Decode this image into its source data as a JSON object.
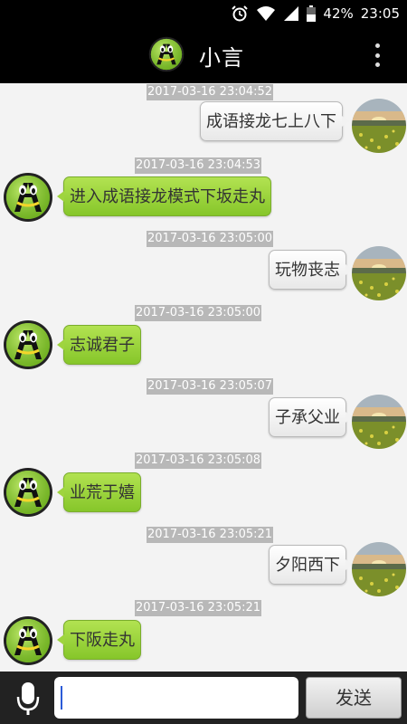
{
  "status_bar": {
    "battery": "42%",
    "time": "23:05",
    "icons": [
      "alarm-icon",
      "wifi-icon",
      "signal-icon",
      "battery-icon"
    ]
  },
  "app_bar": {
    "title": "小言",
    "menu_icon": "overflow-menu-icon"
  },
  "colors": {
    "bot_bubble": "#9fd43e",
    "user_bubble": "#f4f4f4",
    "timestamp_bg": "#b8b8b8",
    "bar_bg": "#000000"
  },
  "messages": [
    {
      "timestamp": "2017-03-16 23:04:52",
      "sender": "user",
      "text": "成语接龙七上八下"
    },
    {
      "timestamp": "2017-03-16 23:04:53",
      "sender": "bot",
      "text": "进入成语接龙模式下坂走丸"
    },
    {
      "timestamp": "2017-03-16 23:05:00",
      "sender": "user",
      "text": "玩物丧志"
    },
    {
      "timestamp": "2017-03-16 23:05:00",
      "sender": "bot",
      "text": "志诚君子"
    },
    {
      "timestamp": "2017-03-16 23:05:07",
      "sender": "user",
      "text": "子承父业"
    },
    {
      "timestamp": "2017-03-16 23:05:08",
      "sender": "bot",
      "text": "业荒于嬉"
    },
    {
      "timestamp": "2017-03-16 23:05:21",
      "sender": "user",
      "text": "夕阳西下"
    },
    {
      "timestamp": "2017-03-16 23:05:21",
      "sender": "bot",
      "text": "下阪走丸"
    }
  ],
  "input": {
    "value": "",
    "send_label": "发送",
    "mic_icon": "microphone-icon"
  }
}
